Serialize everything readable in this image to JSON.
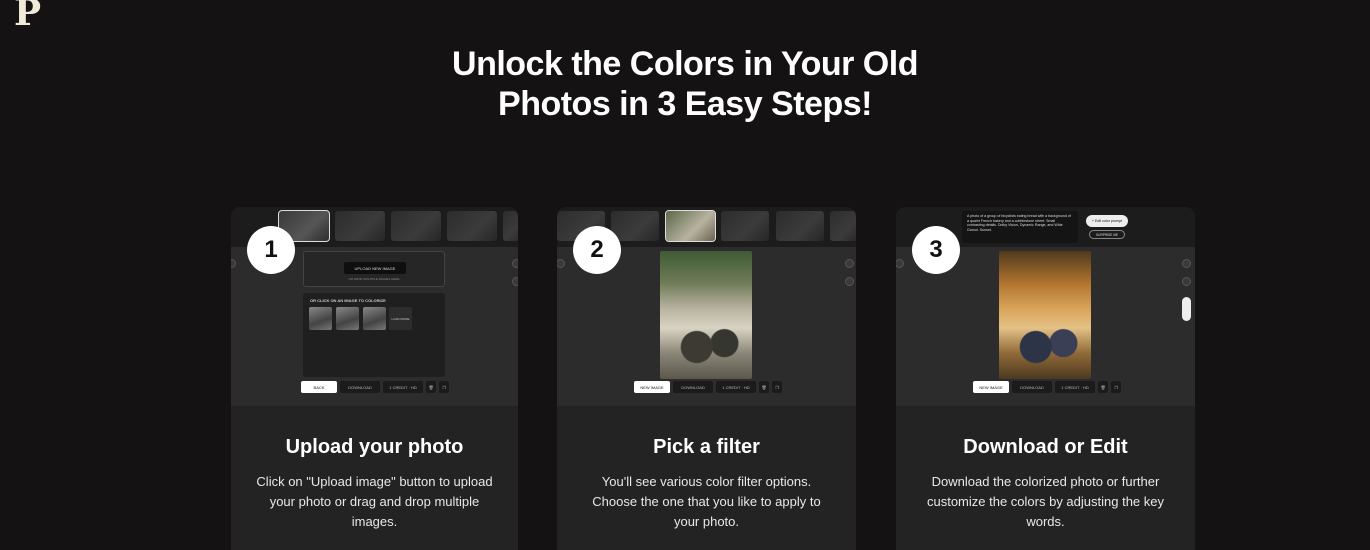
{
  "brand": {
    "logo_letter": "P"
  },
  "hero": {
    "line1": "Unlock the Colors in Your Old",
    "line2": "Photos in 3 Easy Steps!"
  },
  "steps": [
    {
      "number": "1",
      "title": "Upload your photo",
      "description": "Click on \"Upload image\" button to upload your photo or drag and drop multiple images.",
      "shot": {
        "upload_button": "UPLOAD NEW IMAGE",
        "upload_hint": "OR DROP MULTIPLE IMAGES HERE",
        "samples_title": "OR CLICK ON AN IMAGE TO COLORIZE",
        "samples_more": "LOAD MORE",
        "toolbar": [
          "BACK",
          "DOWNLOAD",
          "1 CREDIT · HD"
        ]
      }
    },
    {
      "number": "2",
      "title": "Pick a filter",
      "description": "You'll see various color filter options. Choose the one that you like to apply to your photo.",
      "shot": {
        "toolbar": [
          "NEW IMAGE",
          "DOWNLOAD",
          "1 CREDIT · HD"
        ]
      }
    },
    {
      "number": "3",
      "title": "Download or Edit",
      "description": "Download the colorized photo or further customize the colors by adjusting the key words.",
      "shot": {
        "prompt": "A photo of a group of bicyclists eating bread with a background of a quaint French bakery and a cobblestone street. Small contrasting details. Dolby Vision, Dynamic Range, and Wide Gamut. Sunset.",
        "edit_button": "+ Edit color prompt",
        "surprise_button": "SURPRISE ME",
        "toolbar": [
          "NEW IMAGE",
          "DOWNLOAD",
          "1 CREDIT · HD"
        ]
      }
    }
  ],
  "colors": {
    "background": "#141213",
    "card": "#232323",
    "text": "#ffffff"
  }
}
